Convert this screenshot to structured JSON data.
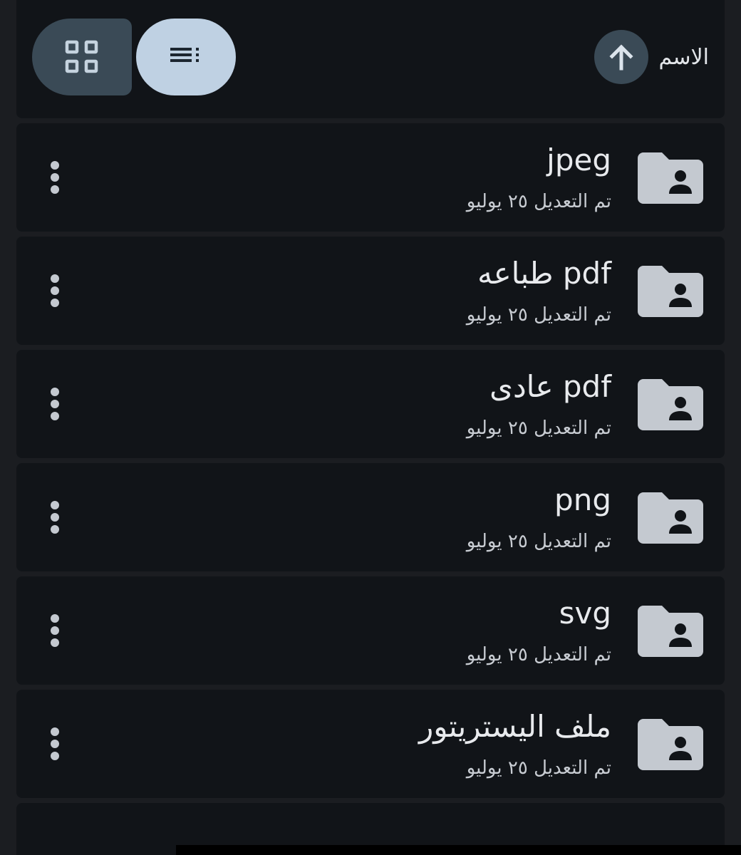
{
  "header": {
    "sort_label": "الاسم",
    "sort_icon": "arrow-up-icon",
    "grid_view_icon": "grid-view-icon",
    "list_view_icon": "list-view-icon"
  },
  "folders": [
    {
      "name": "jpeg",
      "modified": "تم التعديل ٢٥ يوليو"
    },
    {
      "name": "pdf طباعه",
      "modified": "تم التعديل ٢٥ يوليو"
    },
    {
      "name": "pdf عادى",
      "modified": "تم التعديل ٢٥ يوليو"
    },
    {
      "name": "png",
      "modified": "تم التعديل ٢٥ يوليو"
    },
    {
      "name": "svg",
      "modified": "تم التعديل ٢٥ يوليو"
    },
    {
      "name": "ملف اليستريتور",
      "modified": "تم التعديل ٢٥ يوليو"
    }
  ],
  "colors": {
    "background": "#1b1d21",
    "card": "#111418",
    "accent_dark": "#3a4a56",
    "accent_light": "#bfd1e3",
    "icon": "#c4c9d0",
    "text": "#e8eaed"
  }
}
